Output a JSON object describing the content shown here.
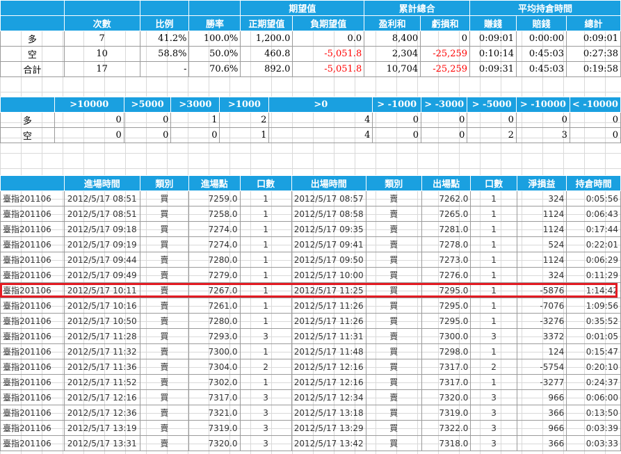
{
  "summary": {
    "group_headers": [
      "期望值",
      "累計總合",
      "平均持倉時間"
    ],
    "headers": [
      "",
      "次數",
      "比例",
      "勝率",
      "正期望值",
      "負期望值",
      "盈利和",
      "虧損和",
      "賺錢",
      "賠錢",
      "總計"
    ],
    "rows": [
      {
        "label": "多",
        "count": "7",
        "ratio": "41.2%",
        "win": "100.0%",
        "pos_ev": "1,200.0",
        "neg_ev": "0.0",
        "profit": "8,400",
        "loss": "0",
        "t_win": "0:09:01",
        "t_loss": "0:00:00",
        "t_total": "0:09:01"
      },
      {
        "label": "空",
        "count": "10",
        "ratio": "58.8%",
        "win": "50.0%",
        "pos_ev": "460.8",
        "neg_ev": "-5,051.8",
        "profit": "2,304",
        "loss": "-25,259",
        "t_win": "0:10:14",
        "t_loss": "0:45:03",
        "t_total": "0:27:38"
      },
      {
        "label": "合計",
        "count": "17",
        "ratio": "-",
        "win": "70.6%",
        "pos_ev": "892.0",
        "neg_ev": "-5,051.8",
        "profit": "10,704",
        "loss": "-25,259",
        "t_win": "0:09:31",
        "t_loss": "0:45:03",
        "t_total": "0:19:58"
      }
    ]
  },
  "distribution": {
    "headers": [
      "",
      ">10000",
      ">5000",
      ">3000",
      ">1000",
      ">0",
      "> -1000",
      "> -3000",
      "> -5000",
      "> -10000",
      "< -10000"
    ],
    "rows": [
      {
        "label": "多",
        "values": [
          "0",
          "0",
          "1",
          "2",
          "4",
          "0",
          "0",
          "0",
          "0",
          "0"
        ]
      },
      {
        "label": "空",
        "values": [
          "0",
          "0",
          "0",
          "1",
          "4",
          "0",
          "0",
          "2",
          "3",
          "0"
        ]
      }
    ]
  },
  "trades": {
    "headers": [
      "",
      "進場時間",
      "類別",
      "進場點",
      "口數",
      "出場時間",
      "類別",
      "出場點",
      "口數",
      "淨損益",
      "持倉時間"
    ],
    "rows": [
      [
        "臺指201106",
        "2012/5/17 08:51",
        "買",
        "7259.0",
        "1",
        "2012/5/17 08:57",
        "賣",
        "7262.0",
        "1",
        "324",
        "0:05:56"
      ],
      [
        "臺指201106",
        "2012/5/17 08:51",
        "買",
        "7258.0",
        "1",
        "2012/5/17 08:58",
        "賣",
        "7265.0",
        "1",
        "1124",
        "0:06:43"
      ],
      [
        "臺指201106",
        "2012/5/17 09:18",
        "買",
        "7274.0",
        "1",
        "2012/5/17 09:35",
        "賣",
        "7281.0",
        "1",
        "1124",
        "0:17:44"
      ],
      [
        "臺指201106",
        "2012/5/17 09:19",
        "買",
        "7274.0",
        "1",
        "2012/5/17 09:41",
        "賣",
        "7278.0",
        "1",
        "524",
        "0:22:01"
      ],
      [
        "臺指201106",
        "2012/5/17 09:44",
        "賣",
        "7280.0",
        "1",
        "2012/5/17 09:50",
        "買",
        "7273.0",
        "1",
        "1124",
        "0:06:29"
      ],
      [
        "臺指201106",
        "2012/5/17 09:49",
        "賣",
        "7279.0",
        "1",
        "2012/5/17 10:00",
        "買",
        "7276.0",
        "1",
        "324",
        "0:11:29"
      ],
      [
        "臺指201106",
        "2012/5/17 10:11",
        "賣",
        "7267.0",
        "1",
        "2012/5/17 11:25",
        "買",
        "7295.0",
        "1",
        "-5876",
        "1:14:42"
      ],
      [
        "臺指201106",
        "2012/5/17 10:16",
        "賣",
        "7261.0",
        "1",
        "2012/5/17 11:26",
        "買",
        "7295.0",
        "1",
        "-7076",
        "1:09:56"
      ],
      [
        "臺指201106",
        "2012/5/17 10:50",
        "賣",
        "7280.0",
        "1",
        "2012/5/17 11:26",
        "買",
        "7295.0",
        "1",
        "-3276",
        "0:35:52"
      ],
      [
        "臺指201106",
        "2012/5/17 11:28",
        "買",
        "7293.0",
        "3",
        "2012/5/17 11:31",
        "賣",
        "7300.0",
        "3",
        "3372",
        "0:01:05"
      ],
      [
        "臺指201106",
        "2012/5/17 11:32",
        "賣",
        "7300.0",
        "1",
        "2012/5/17 11:48",
        "買",
        "7298.0",
        "1",
        "124",
        "0:15:47"
      ],
      [
        "臺指201106",
        "2012/5/17 11:36",
        "賣",
        "7304.0",
        "2",
        "2012/5/17 12:16",
        "買",
        "7317.0",
        "2",
        "-5754",
        "0:20:10"
      ],
      [
        "臺指201106",
        "2012/5/17 11:52",
        "賣",
        "7302.0",
        "1",
        "2012/5/17 12:16",
        "買",
        "7317.0",
        "1",
        "-3277",
        "0:24:37"
      ],
      [
        "臺指201106",
        "2012/5/17 12:16",
        "買",
        "7317.0",
        "3",
        "2012/5/17 12:34",
        "賣",
        "7320.0",
        "3",
        "966",
        "0:06:00"
      ],
      [
        "臺指201106",
        "2012/5/17 12:36",
        "賣",
        "7321.0",
        "3",
        "2012/5/17 13:18",
        "買",
        "7319.0",
        "3",
        "366",
        "0:13:50"
      ],
      [
        "臺指201106",
        "2012/5/17 13:19",
        "賣",
        "7319.0",
        "3",
        "2012/5/17 13:29",
        "買",
        "7322.0",
        "3",
        "966",
        "0:03:39"
      ],
      [
        "臺指201106",
        "2012/5/17 13:31",
        "賣",
        "7320.0",
        "3",
        "2012/5/17 13:42",
        "買",
        "7318.0",
        "3",
        "366",
        "0:03:33"
      ]
    ],
    "highlighted_row": 6
  },
  "colors": {
    "header_bg": "#1aa0e0",
    "negative": "#ff0000",
    "buy": "#e00000",
    "sell": "#009050",
    "highlight_border": "#e31b23"
  }
}
